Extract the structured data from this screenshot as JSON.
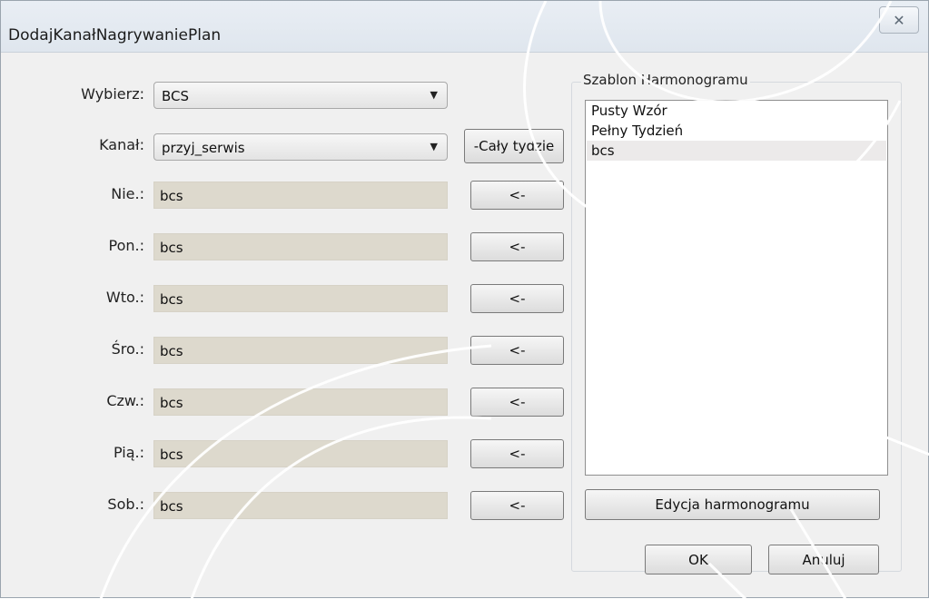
{
  "window": {
    "title": "DodajKanałNagrywaniePlan",
    "close_glyph": "✕"
  },
  "form": {
    "wybierz": {
      "label": "Wybierz:",
      "value": "BCS"
    },
    "kanal": {
      "label": "Kanał:",
      "value": "przyj_serwis"
    },
    "whole_week_button": "-Cały tydzie",
    "arrow_label": "<-",
    "days": [
      {
        "label": "Nie.:",
        "value": "bcs"
      },
      {
        "label": "Pon.:",
        "value": "bcs"
      },
      {
        "label": "Wto.:",
        "value": "bcs"
      },
      {
        "label": "Śro.:",
        "value": "bcs"
      },
      {
        "label": "Czw.:",
        "value": "bcs"
      },
      {
        "label": "Pią.:",
        "value": "bcs"
      },
      {
        "label": "Sob.:",
        "value": "bcs"
      }
    ]
  },
  "template_panel": {
    "title": "Szablon Harmonogramu",
    "items": [
      "Pusty Wzór",
      "Pełny Tydzień",
      "bcs"
    ],
    "selected_index": 2,
    "edit_button": "Edycja harmonogramu"
  },
  "footer": {
    "ok": "OK",
    "cancel": "Anuluj"
  }
}
